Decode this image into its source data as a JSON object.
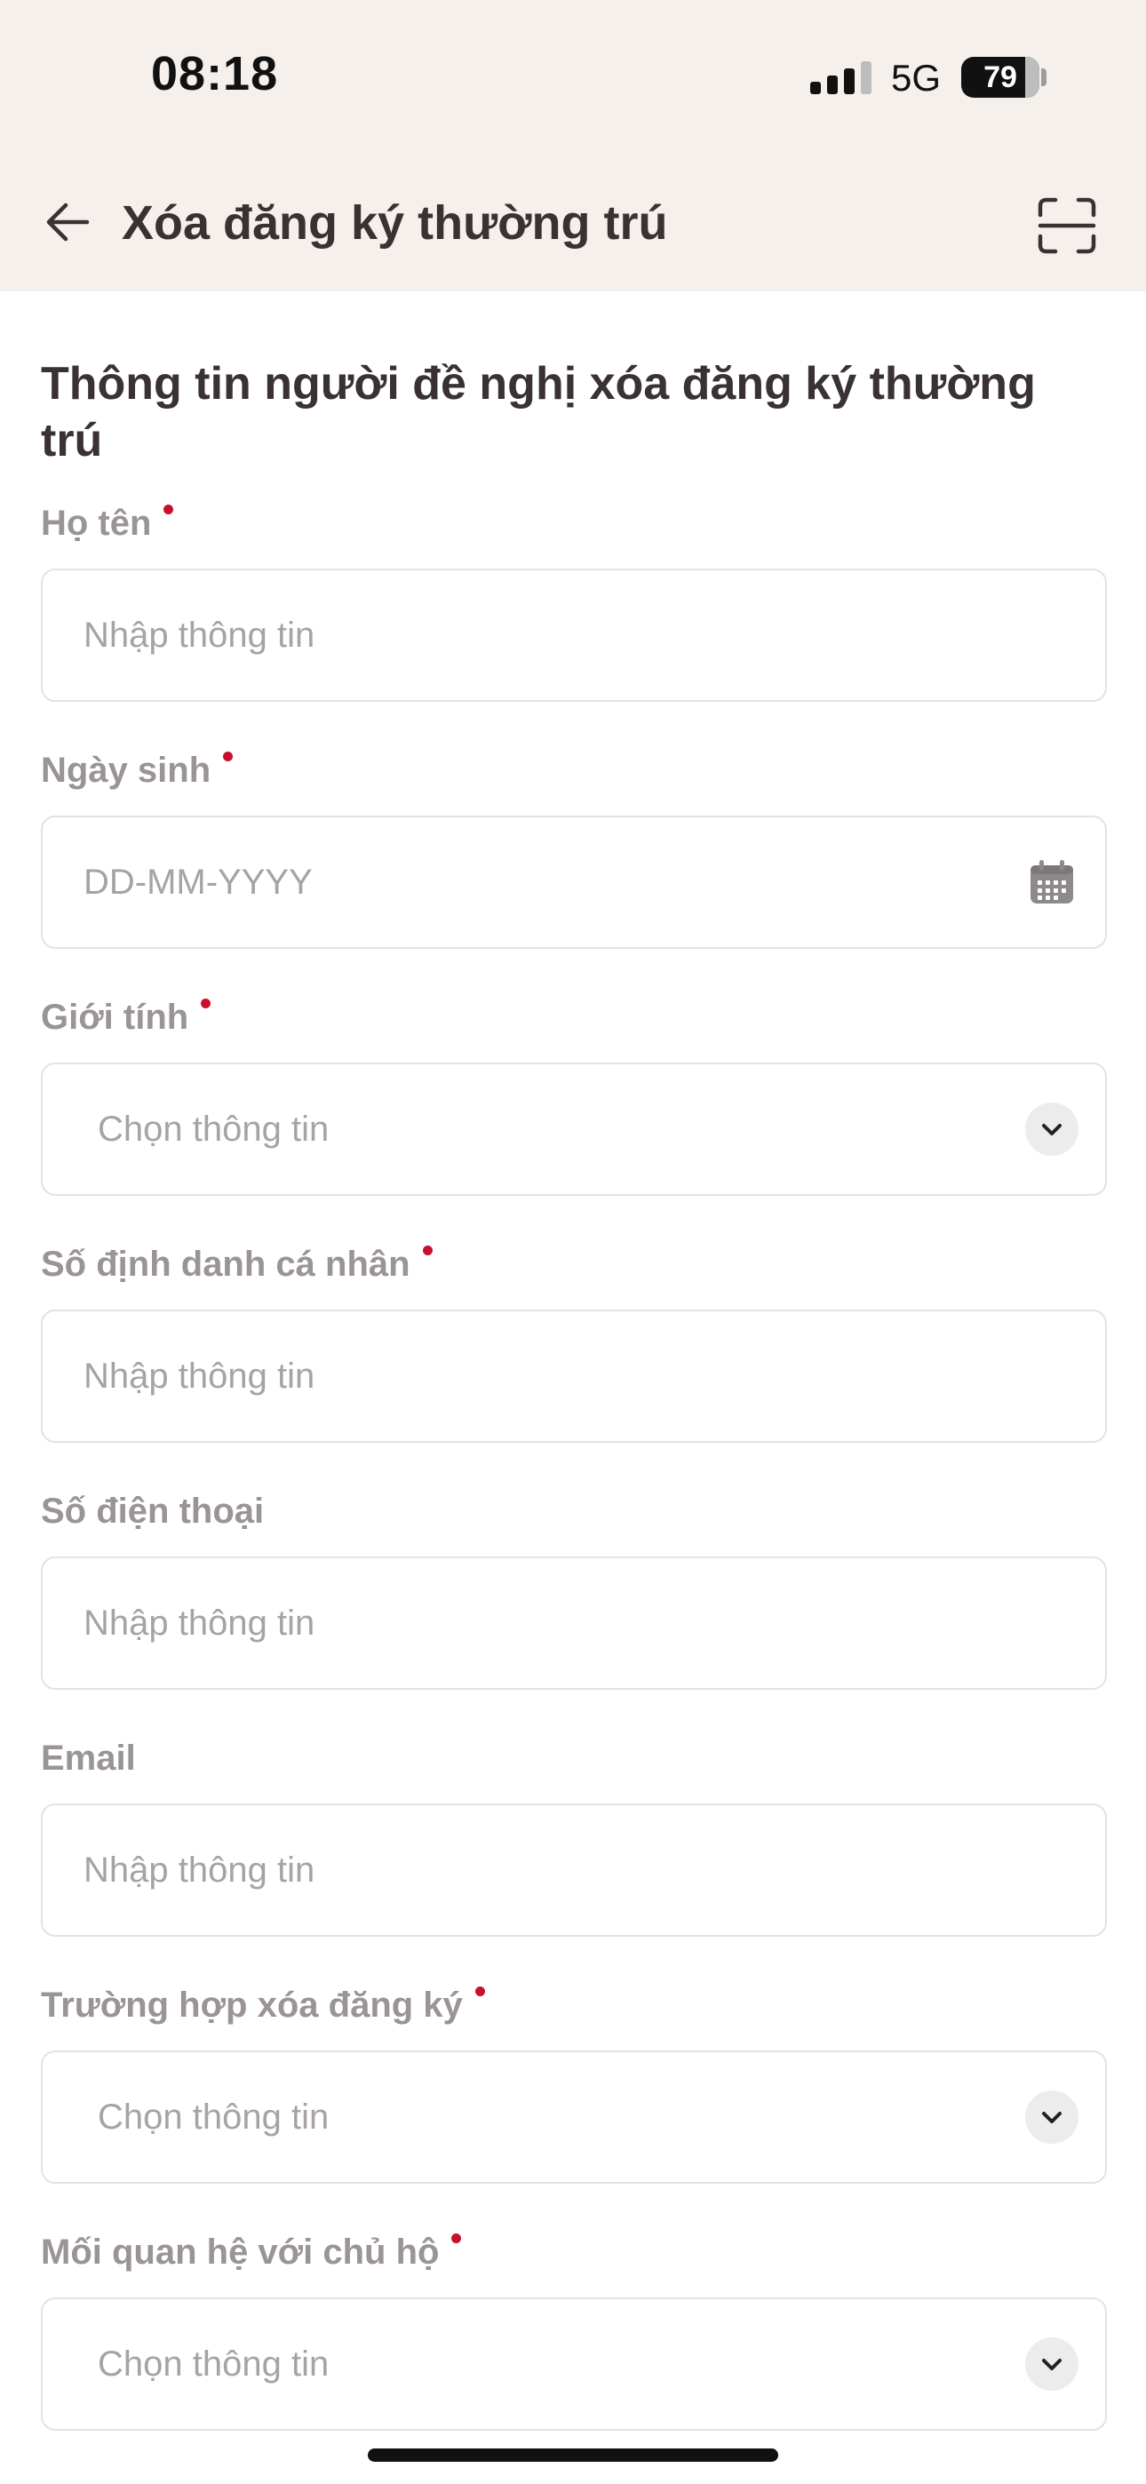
{
  "status_bar": {
    "time": "08:18",
    "network": "5G",
    "battery": "79",
    "icons": [
      "signal-icon",
      "battery-icon"
    ]
  },
  "header": {
    "title": "Xóa đăng ký thường trú",
    "icons": [
      "back-arrow-icon",
      "scan-icon"
    ]
  },
  "form": {
    "section_title": "Thông tin người đề nghị xóa đăng ký thường trú",
    "accent_color": "#c8102e",
    "fields": {
      "ho_ten": {
        "label": "Họ tên",
        "placeholder": "Nhập thông tin"
      },
      "ngay_sinh": {
        "label": "Ngày sinh",
        "placeholder": "DD-MM-YYYY"
      },
      "gioi_tinh": {
        "label": "Giới tính",
        "placeholder": "Chọn thông tin"
      },
      "so_dinh_danh": {
        "label": "Số định danh cá nhân",
        "placeholder": "Nhập thông tin"
      },
      "so_dien_thoai": {
        "label": "Số điện thoại",
        "placeholder": "Nhập thông tin"
      },
      "email": {
        "label": "Email",
        "placeholder": "Nhập thông tin"
      },
      "truong_hop": {
        "label": "Trường hợp xóa đăng ký",
        "placeholder": "Chọn thông tin"
      },
      "quan_he": {
        "label": "Mối quan hệ với chủ hộ",
        "placeholder": "Chọn thông tin"
      }
    }
  }
}
